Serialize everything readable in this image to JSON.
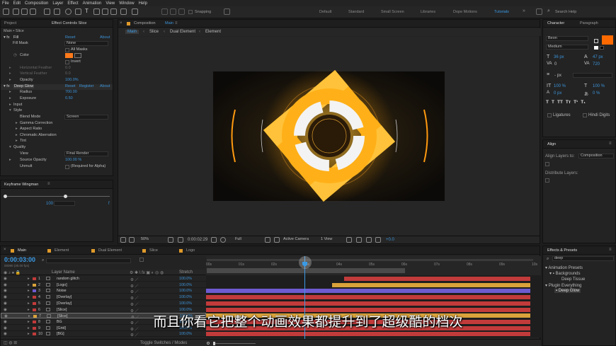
{
  "menu": [
    "File",
    "Edit",
    "Composition",
    "Layer",
    "Effect",
    "Animation",
    "View",
    "Window",
    "Help"
  ],
  "toolbar": {
    "snapping": "Snapping",
    "workspaces": [
      "Default",
      "Standard",
      "Small Screen",
      "Libraries",
      "Dope Motions",
      "Tutorials"
    ],
    "search_placeholder": "Search Help"
  },
  "left_panel": {
    "tabs": [
      "Project",
      "Effect Controls Slice"
    ],
    "breadcrumb": "Main • Slice",
    "fill": {
      "name": "Fill",
      "reset": "Reset",
      "about": "About",
      "fill_mask_label": "Fill Mask",
      "fill_mask_value": "None",
      "all_masks": "All Masks",
      "color_label": "Color",
      "invert": "Invert",
      "h_feather": "Horizontal Feather",
      "v_feather": "Vertical Feather",
      "h_val": "0.0",
      "v_val": "0.0",
      "opacity_label": "Opacity",
      "opacity_val": "100.0%",
      "color": "#ff7a1a"
    },
    "glow": {
      "name": "Deep Glow",
      "reset": "Reset",
      "register": "Register",
      "about": "About",
      "radius_label": "Radius",
      "radius_val": "700.00",
      "exposure_label": "Exposure",
      "exposure_val": "0.50",
      "input": "Input",
      "style": "Style",
      "blend_label": "Blend Mode",
      "blend_val": "Screen",
      "gamma": "Gamma Correction",
      "aspect": "Aspect Ratio",
      "chromatic": "Chromatic Aberration",
      "tint": "Tint",
      "quality": "Quality",
      "view_label": "View",
      "view_val": "Final Render",
      "source_label": "Source Opacity",
      "source_val": "100.00 %",
      "unmult": "Unmult",
      "unmult_note": "(Required for Alpha)"
    }
  },
  "wingman": {
    "title": "Keyframe Wingman",
    "value": "100",
    "f": "f"
  },
  "comp": {
    "tab_prefix": "Composition",
    "tab_name": "Main",
    "crumbs": [
      "Main",
      "Slice",
      "Dual Element",
      "Element"
    ],
    "zoom": "50%",
    "time": "0:00:02:29",
    "res": "Full",
    "camera": "Active Camera",
    "view": "1 View",
    "offset": "+0.0"
  },
  "character": {
    "tabs": [
      "Character",
      "Paragraph"
    ],
    "font": "Beon",
    "style": "Medium",
    "size": "36 px",
    "leading": "47 px",
    "kerning": "0",
    "tracking": "720",
    "stroke": "- px",
    "vscale": "100 %",
    "hscale": "100 %",
    "baseline": "0 px",
    "tsume": "0 %",
    "ligatures": "Ligatures",
    "hindi": "Hindi Digits",
    "accent": "#ff6a00"
  },
  "align": {
    "title": "Align",
    "label": "Align Layers to:",
    "target": "Composition",
    "distribute": "Distribute Layers:"
  },
  "effects": {
    "title": "Effects & Presets",
    "query": "deep",
    "items": [
      "Animation Presets",
      "Backgrounds",
      "Deep Tissue",
      "Plugin Everything",
      "Deep Glow"
    ]
  },
  "timeline": {
    "tabs": [
      "Main",
      "Element",
      "Dual Element",
      "Slice",
      "Logo"
    ],
    "timecode": "0:00:03:00",
    "fps": "00090 (30.00 fps)",
    "col_name": "Layer Name",
    "col_stretch": "Stretch",
    "layers": [
      {
        "n": "1",
        "name": "random glitch",
        "s": "100.0%",
        "c": "#c23b3b"
      },
      {
        "n": "2",
        "name": "[Logo]",
        "s": "100.0%",
        "c": "#d9a23a"
      },
      {
        "n": "3",
        "name": "Noise",
        "s": "100.0%",
        "c": "#6d5bd0"
      },
      {
        "n": "4",
        "name": "[Overlay]",
        "s": "100.0%",
        "c": "#c23b3b"
      },
      {
        "n": "5",
        "name": "[Overlay]",
        "s": "100.0%",
        "c": "#c23b3b"
      },
      {
        "n": "6",
        "name": "[Slice]",
        "s": "100.0%",
        "c": "#c23b3b"
      },
      {
        "n": "7",
        "name": "[Slice]",
        "s": "100.0%",
        "c": "#d9a23a"
      },
      {
        "n": "8",
        "name": "BG",
        "s": "100.0%",
        "c": "#c23b3b"
      },
      {
        "n": "9",
        "name": "[Grid]",
        "s": "100.0%",
        "c": "#c23b3b"
      },
      {
        "n": "10",
        "name": "[BG]",
        "s": "100.0%",
        "c": "#c23b3b"
      }
    ],
    "ruler": [
      "00s",
      "01s",
      "02s",
      "03s",
      "04s",
      "05s",
      "06s",
      "07s",
      "08s",
      "09s",
      "10s"
    ],
    "footer": "Toggle Switches / Modes"
  },
  "subtitle": "而且你看它把整个动画效果都提升到了超级酷的档次"
}
